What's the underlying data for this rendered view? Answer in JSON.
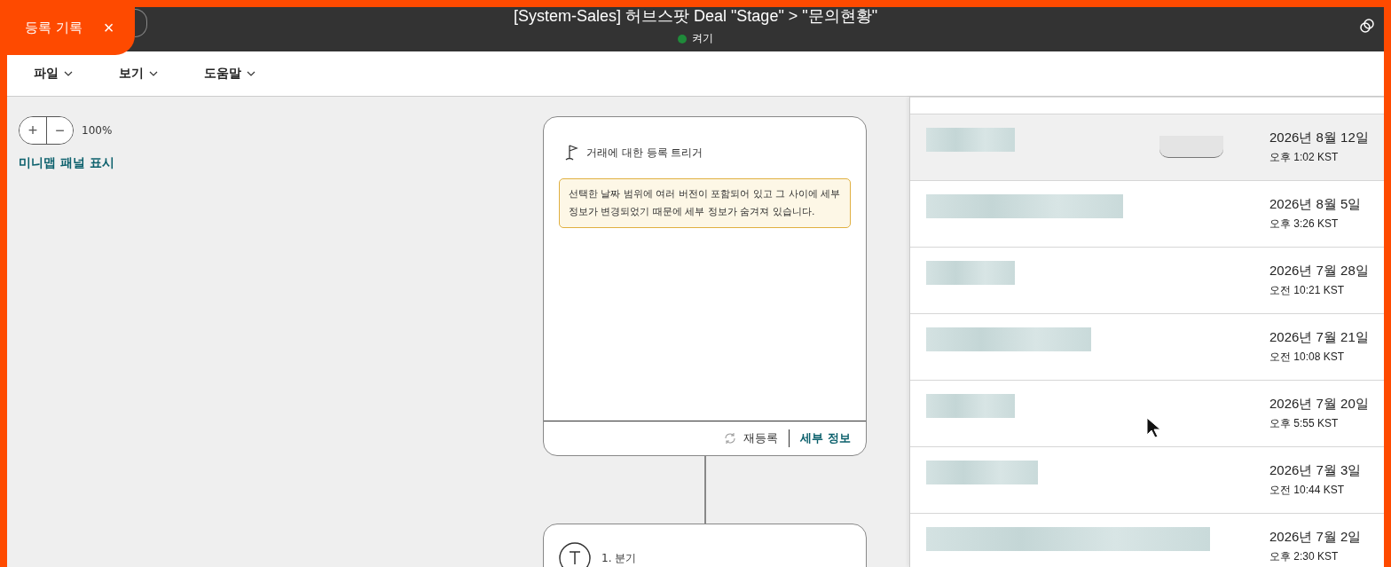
{
  "history_tab": {
    "label": "등록 기록",
    "close": "×"
  },
  "window": {
    "title": "[System-Sales] 허브스팟 Deal \"Stage\" > \"문의현황\"",
    "status": "켜기",
    "status_on": true
  },
  "menu": [
    {
      "label": "파일"
    },
    {
      "label": "보기"
    },
    {
      "label": "도움말"
    }
  ],
  "zoom": {
    "plus": "+",
    "minus": "−",
    "value": "100%"
  },
  "minimap_link": "미니맵 패널 표시",
  "trigger_card": {
    "title": "거래에 대한 등록 트리거",
    "warning": "선택한 날짜 범위에 여러 버전이 포함되어 있고 그 사이에 세부 정보가 변경되었기 때문에 세부 정보가 숨겨져 있습니다.",
    "reenroll": "재등록",
    "details": "세부 정보"
  },
  "branch_card": {
    "title": "1. 분기"
  },
  "history": [
    {
      "selected": true,
      "badge": true,
      "date": "2026년 8월 12일",
      "time": "오후 1:02 KST"
    },
    {
      "selected": false,
      "badge": false,
      "date": "2026년 8월 5일",
      "time": "오후 3:26 KST"
    },
    {
      "selected": false,
      "badge": false,
      "date": "2026년 7월 28일",
      "time": "오전 10:21 KST"
    },
    {
      "selected": false,
      "badge": false,
      "date": "2026년 7월 21일",
      "time": "오전 10:08 KST"
    },
    {
      "selected": false,
      "badge": false,
      "date": "2026년 7월 20일",
      "time": "오후 5:55 KST"
    },
    {
      "selected": false,
      "badge": false,
      "date": "2026년 7월 3일",
      "time": "오전 10:44 KST"
    },
    {
      "selected": false,
      "badge": false,
      "date": "2026년 7월 2일",
      "time": "오후 2:30 KST"
    }
  ]
}
